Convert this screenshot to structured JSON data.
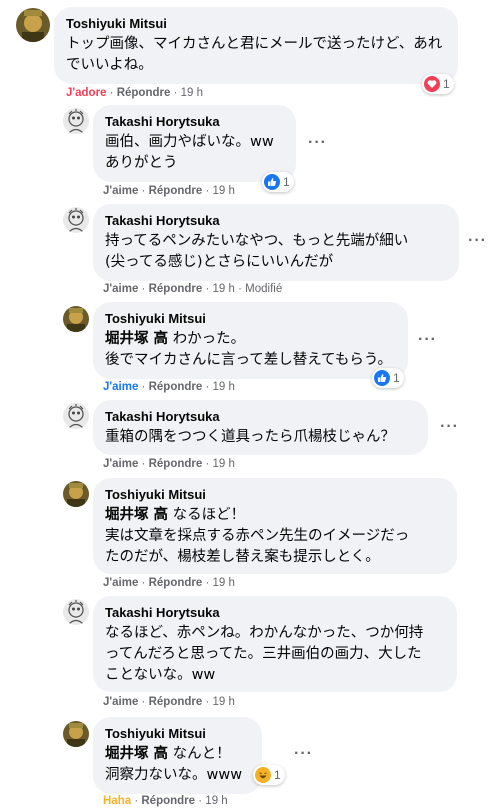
{
  "comments": [
    {
      "author": "Toshiyuki Mitsui",
      "lines": [
        "トップ画像、マイカさんと君にメールで送ったけど、あれ",
        "でいいよね。"
      ],
      "reaction": {
        "type": "heart",
        "count": "1"
      },
      "actions": {
        "like": "J'adore",
        "reply": "Répondre",
        "sep": "·",
        "time": "19 h"
      }
    },
    {
      "author": "Takashi Horytsuka",
      "lines": [
        "画伯、画力やばいな。ww",
        "ありがとう"
      ],
      "reaction": {
        "type": "like",
        "count": "1"
      },
      "actions": {
        "like": "J'aime",
        "reply": "Répondre",
        "sep": "·",
        "time": "19 h"
      }
    },
    {
      "author": "Takashi Horytsuka",
      "lines": [
        "持ってるペンみたいなやつ、もっと先端が細い",
        "(尖ってる感じ)とさらにいいんだが"
      ],
      "actions": {
        "like": "J'aime",
        "reply": "Répondre",
        "sep": "·",
        "time": "19 h",
        "edited": "Modifié"
      }
    },
    {
      "author": "Toshiyuki Mitsui",
      "mention": "堀井塚 高",
      "lines": [
        "わかった。",
        "後でマイカさんに言って差し替えてもらう。"
      ],
      "reaction": {
        "type": "like",
        "count": "1"
      },
      "actions": {
        "like": "J'aime",
        "reply": "Répondre",
        "sep": "·",
        "time": "19 h"
      }
    },
    {
      "author": "Takashi Horytsuka",
      "lines": [
        "重箱の隅をつつく道具ったら爪楊枝じゃん？"
      ],
      "actions": {
        "like": "J'aime",
        "reply": "Répondre",
        "sep": "·",
        "time": "19 h"
      }
    },
    {
      "author": "Toshiyuki Mitsui",
      "mention": "堀井塚 高",
      "lines": [
        "なるほど！",
        "実は文章を採点する赤ペン先生のイメージだっ",
        "たのだが、楊枝差し替え案も提示しとく。"
      ],
      "actions": {
        "like": "J'aime",
        "reply": "Répondre",
        "sep": "·",
        "time": "19 h"
      }
    },
    {
      "author": "Takashi Horytsuka",
      "lines": [
        "なるほど、赤ペンね。わかんなかった、つか何持",
        "ってんだろと思ってた。三井画伯の画力、大した",
        "ことないな。ww"
      ],
      "actions": {
        "like": "J'aime",
        "reply": "Répondre",
        "sep": "·",
        "time": "19 h"
      }
    },
    {
      "author": "Toshiyuki Mitsui",
      "mention": "堀井塚 高",
      "lines": [
        "なんと！",
        "洞察力ないな。www"
      ],
      "reaction": {
        "type": "haha",
        "count": "1"
      },
      "actions": {
        "like": "Haha",
        "reply": "Répondre",
        "sep": "·",
        "time": "19 h"
      }
    }
  ],
  "more_icon": "more-options-icon",
  "colors": {
    "bubble": "#f0f2f5",
    "meta": "#65676b",
    "like_blue": "#1877f2",
    "adore_red": "#f33e58",
    "haha_yellow": "#f7b125"
  }
}
